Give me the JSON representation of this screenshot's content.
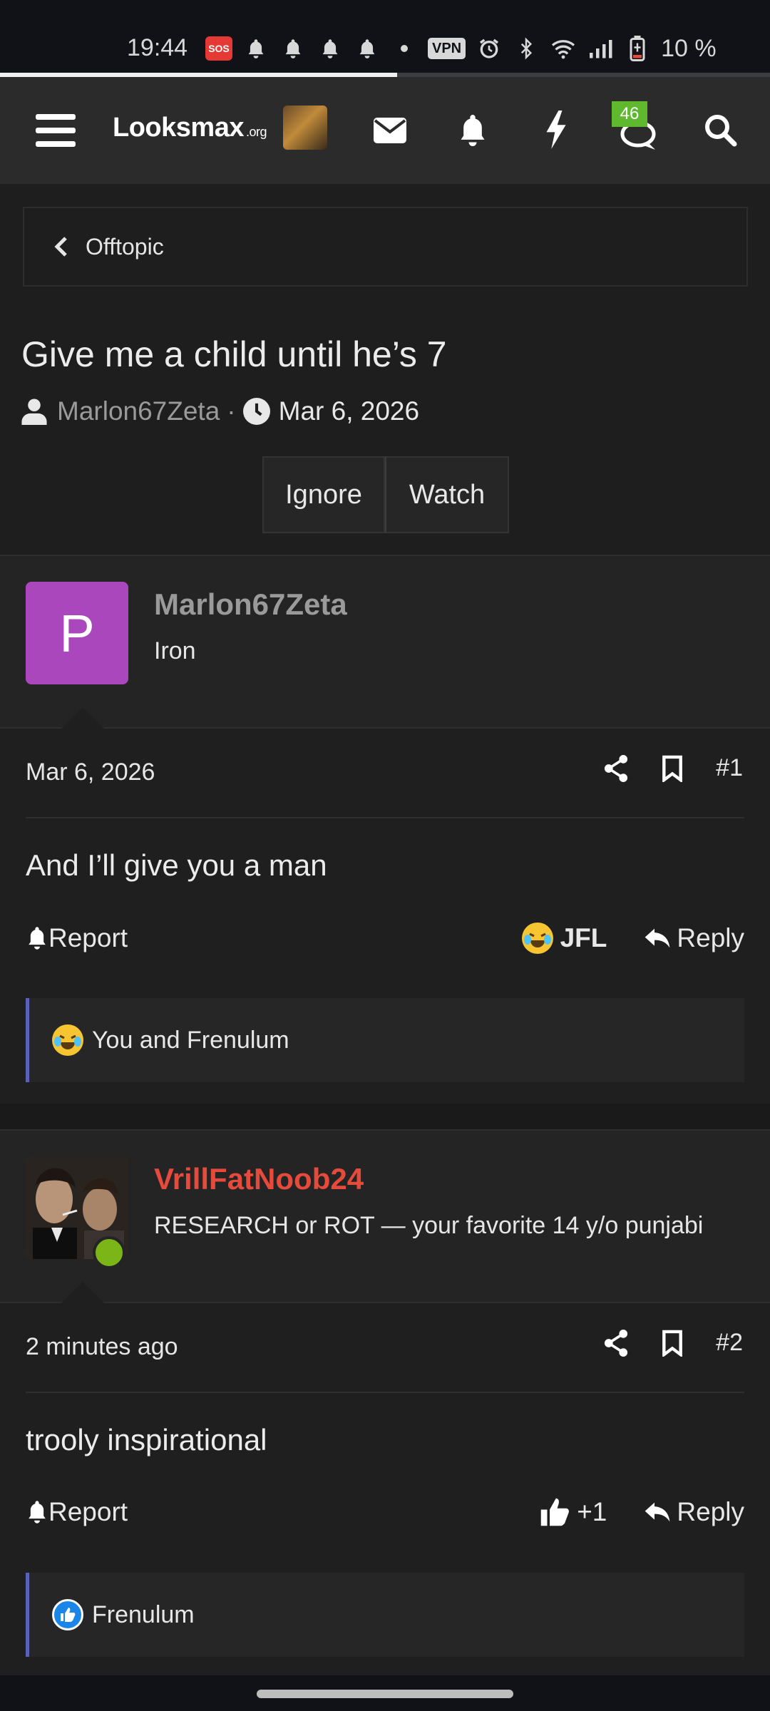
{
  "status": {
    "time": "19:44",
    "sos": "SOS",
    "vpn": "VPN",
    "battery": "10 %",
    "page_load_progress": 0.52
  },
  "header": {
    "logo": "Looksmax",
    "logo_suffix": ".org",
    "chat_badge": "46",
    "icons": [
      "menu-icon",
      "avatar",
      "envelope-icon",
      "bell-icon",
      "bolt-icon",
      "chat-icon",
      "search-icon"
    ]
  },
  "breadcrumb": {
    "label": "Offtopic"
  },
  "thread": {
    "title": "Give me a child until he’s 7",
    "author": "Marlon67Zeta",
    "separator": "·",
    "date": "Mar 6, 2026",
    "ignore_label": "Ignore",
    "watch_label": "Watch"
  },
  "posts": [
    {
      "username": "Marlon67Zeta",
      "username_color": "#9a9a9a",
      "user_title": "Iron",
      "avatar_letter": "P",
      "avatar_color": "#ab47bc",
      "date": "Mar 6, 2026",
      "post_number": "#1",
      "text": "And I’ll give you a man",
      "report_label": "Report",
      "reaction_label": "JFL",
      "reply_label": "Reply",
      "reactions_summary": "You and Frenulum"
    },
    {
      "username": "VrillFatNoob24",
      "username_color": "#e64a3b",
      "user_title": "RESEARCH or ROT — your favorite 14 y/o punjabi",
      "online": true,
      "date": "2 minutes ago",
      "post_number": "#2",
      "text": "trooly inspirational",
      "report_label": "Report",
      "reaction_label": "+1",
      "reply_label": "Reply",
      "reactions_summary": "Frenulum"
    }
  ]
}
